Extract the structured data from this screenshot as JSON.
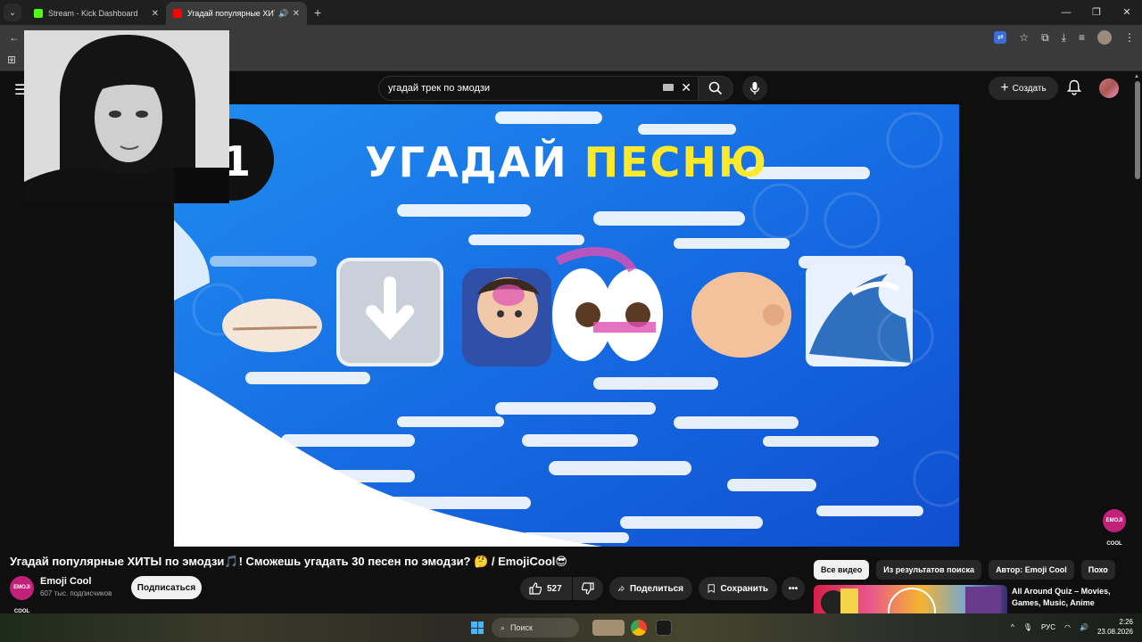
{
  "browser": {
    "tabs": [
      {
        "title": "Stream - Kick Dashboard",
        "active": false,
        "favicon_color": "#53fc18"
      },
      {
        "title": "Угадай популярные ХИТЫ",
        "active": true,
        "favicon_color": "#ff0000"
      }
    ],
    "url_fragment": "u",
    "window_controls": [
      "—",
      "❐",
      "✕"
    ]
  },
  "youtube": {
    "search": {
      "value": "угадай трек по эмодзи"
    },
    "create_label": "Создать",
    "video": {
      "title_overlay_part1": "УГАДАЙ",
      "title_overlay_part2": "ПЕСНЮ",
      "number_badge": "1",
      "badge_text": "EMOJI COOL"
    },
    "title": "Угадай популярные ХИТЫ по эмодзи🎵! Сможешь угадать 30 песен по эмодзи? 🤔 / EmojiCool😎",
    "channel": {
      "name": "Emoji Cool",
      "subscribers": "607 тыс. подписчиков",
      "avatar_text": "EMOJI COOL"
    },
    "subscribe_label": "Подписаться",
    "likes": "527",
    "share_label": "Поделиться",
    "save_label": "Сохранить",
    "chips": [
      "Все видео",
      "Из результатов поиска",
      "Автор: Emoji Cool",
      "Похо"
    ],
    "recommendation": {
      "title": "All Around Quiz – Movies, Games, Music, Anime"
    }
  },
  "taskbar": {
    "search_label": "Поиск",
    "language": "РУС",
    "time": "2:26",
    "date": "23.08.2026"
  },
  "colors": {
    "accent_red": "#ff0000",
    "video_blue": "#1b6fe0",
    "highlight_yellow": "#ffe92c",
    "channel_pink": "#c2217a"
  }
}
